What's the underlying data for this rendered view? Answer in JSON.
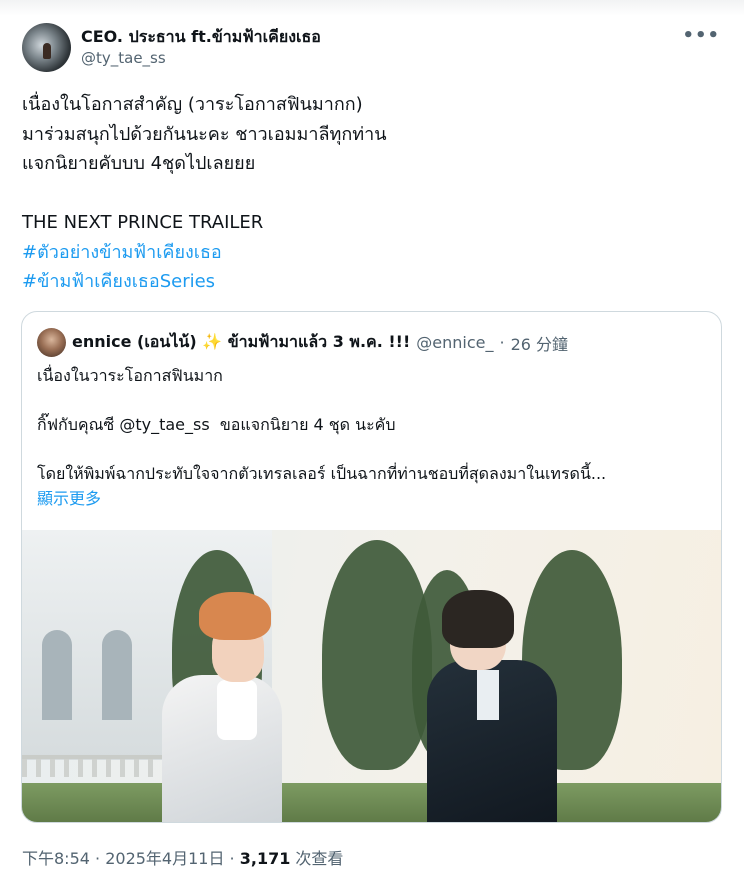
{
  "author": {
    "display_name": "CEO. ประธาน ft.ข้ามฟ้าเคียงเธอ",
    "handle": "@ty_tae_ss"
  },
  "more_icon": "more-horizontal-icon",
  "tweet": {
    "lines": [
      "เนื่องในโอกาสสำคัญ (วาระโอกาสฟินมากก)",
      "มาร่วมสนุกไปด้วยกันนะคะ ชาวเอมมาลีทุกท่าน",
      "แจกนิยายคับบบ 4ชุดไปเลยยย",
      "THE NEXT PRINCE TRAILER"
    ],
    "hashtags": [
      "#ตัวอย่างข้ามฟ้าเคียงเธอ",
      "#ข้ามฟ้าเคียงเธอSeries"
    ]
  },
  "quote": {
    "display_name": "ennice (เอนไน้) ✨ ข้ามฟ้ามาแล้ว 3 พ.ค. !!!",
    "handle": "@ennice_",
    "separator": "·",
    "time": "26 分鐘",
    "lines": [
      "เนื่องในวาระโอกาสฟินมาก",
      "กิ๊ฟกับคุณซี @ty_tae_ss  ขอแจกนิยาย 4 ชุด นะคับ",
      "โดยให้พิมพ์ฉากประทับใจจากตัวเทรลเลอร์ เป็นฉากที่ท่านชอบที่สุดลงมาในเทรดนี้..."
    ],
    "show_more": "顯示更多"
  },
  "meta": {
    "time": "下午8:54",
    "sep1": " · ",
    "date": "2025年4月11日",
    "sep2": " · ",
    "views": "3,171",
    "views_label": " 次查看"
  }
}
